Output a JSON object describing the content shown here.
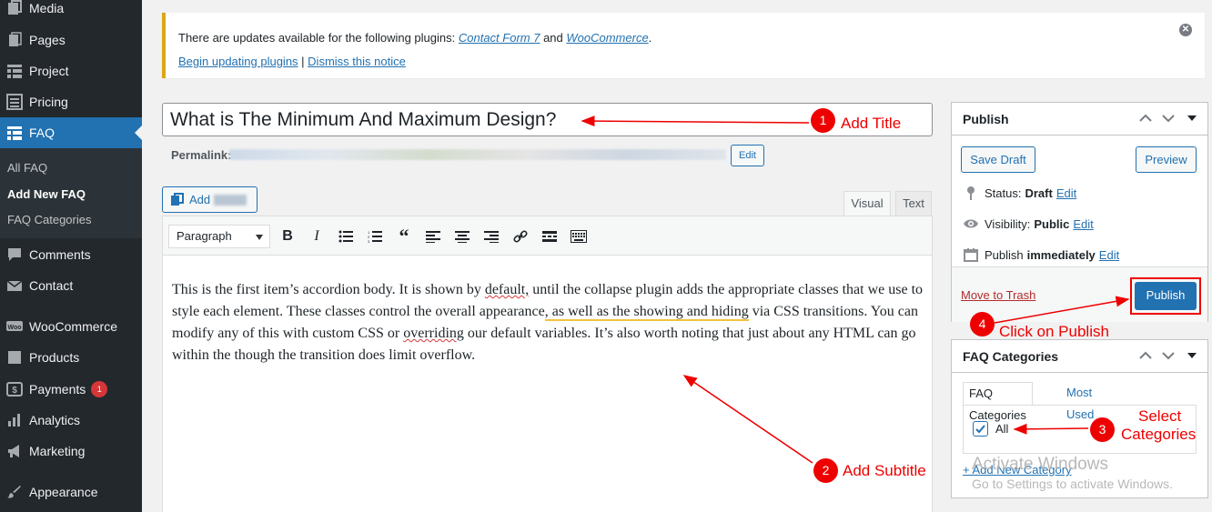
{
  "sidebar": {
    "items": [
      {
        "label": "Media",
        "icon": "media-icon"
      },
      {
        "label": "Pages",
        "icon": "pages-icon"
      },
      {
        "label": "Project",
        "icon": "project-icon"
      },
      {
        "label": "Pricing",
        "icon": "pricing-icon"
      },
      {
        "label": "FAQ",
        "icon": "faq-icon"
      },
      {
        "label": "Comments",
        "icon": "comments-icon"
      },
      {
        "label": "Contact",
        "icon": "contact-icon"
      },
      {
        "label": "WooCommerce",
        "icon": "woocommerce-icon"
      },
      {
        "label": "Products",
        "icon": "products-icon"
      },
      {
        "label": "Payments",
        "icon": "payments-icon",
        "badge": "1"
      },
      {
        "label": "Analytics",
        "icon": "analytics-icon"
      },
      {
        "label": "Marketing",
        "icon": "marketing-icon"
      },
      {
        "label": "Appearance",
        "icon": "appearance-icon"
      }
    ],
    "submenu": [
      "All FAQ",
      "Add New FAQ",
      "FAQ Categories"
    ]
  },
  "notice": {
    "prefix": "There are updates available for the following plugins: ",
    "plugin1": "Contact Form 7",
    "and": " and ",
    "plugin2": "WooCommerce",
    "period": ".",
    "begin_link": "Begin updating plugins",
    "separator": " | ",
    "dismiss_link": "Dismiss this notice"
  },
  "editor": {
    "title_value": "What is The Minimum And Maximum Design?",
    "permalink_label": "Permalink:",
    "edit_label": "Edit",
    "add_media_label": "Add",
    "tab_visual": "Visual",
    "tab_text": "Text",
    "format_value": "Paragraph",
    "body": {
      "p1": "This is the first item’s accordion body. It is shown by ",
      "w1": "default,",
      "p2": " until the collapse plugin adds the appropriate classes that we use to style each element. These classes control the overall appearance",
      "w2": ", as well as the showing and hiding",
      "p3": " via CSS transitions. You can modify any of this with custom CSS or ",
      "w3": "overriding",
      "p4": " our default variables. It’s also worth noting that just about any HTML can go within the though the transition does limit overflow."
    }
  },
  "publish": {
    "title": "Publish",
    "save_draft": "Save Draft",
    "preview": "Preview",
    "status_label": "Status:",
    "status_value": "Draft",
    "visibility_label": "Visibility:",
    "visibility_value": "Public",
    "publish_label": "Publish",
    "publish_value": "immediately",
    "edit": "Edit",
    "move_to_trash": "Move to Trash",
    "publish_button": "Publish"
  },
  "categories": {
    "title": "FAQ Categories",
    "tab_all": "FAQ Categories",
    "tab_used": "Most Used",
    "item_all": "All",
    "add_new": "+ Add New Category"
  },
  "annotations": {
    "a1_num": "1",
    "a1_text": "Add Title",
    "a2_num": "2",
    "a2_text": "Add Subtitle",
    "a3_num": "3",
    "a3_text1": "Select",
    "a3_text2": "Categories",
    "a4_num": "4",
    "a4_text": "Click on Publish",
    "color": "#e00000"
  },
  "watermark": {
    "line1": "Activate Windows",
    "line2": "Go to Settings to activate Windows."
  },
  "colors": {
    "sidebar_bg": "#23282d",
    "active_blue": "#2271b1",
    "notice_border": "#dba617"
  }
}
